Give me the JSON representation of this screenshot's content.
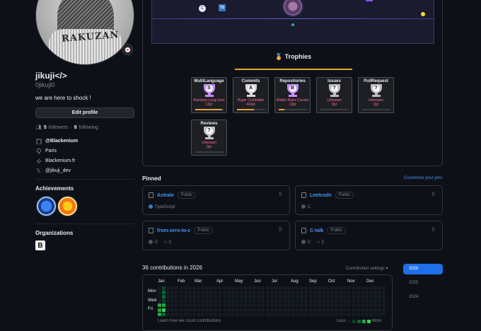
{
  "profile": {
    "avatar_text": "RAKUZAN",
    "name": "jikuji</>",
    "login": "0jikuji0",
    "bio": "we are here to shock !",
    "edit_label": "Edit profile",
    "followers_count": "5",
    "followers_label": "followers",
    "dot_sep": "·",
    "following_count": "8",
    "following_label": "following",
    "company": "@Blackenium",
    "location": "Paris",
    "website": "Blackenium.fr",
    "x_handle": "@jikuji_dev"
  },
  "achievements": {
    "title": "Achievements"
  },
  "organizations": {
    "title": "Organizations",
    "org_letter": "B"
  },
  "readme": {
    "skill_labels": [
      "C",
      "TS"
    ],
    "trophies_title": "🏅 Trophies",
    "trophies": [
      {
        "title": "MultiLanguage",
        "rank": "S",
        "sub": "Rainbow Lang User",
        "pts": "13pt",
        "progress": 0.95,
        "cup": "#c48cff"
      },
      {
        "title": "Commits",
        "rank": "A",
        "sub": "Hyper Committer",
        "pts": "424pt",
        "progress": 0.6,
        "cup": "#d8d8d8"
      },
      {
        "title": "Repositories",
        "rank": "B",
        "sub": "Middle Repo Creator",
        "pts": "12pt",
        "progress": 0.2,
        "cup": "#c48cff"
      },
      {
        "title": "Issues",
        "rank": "?",
        "sub": "Unknown",
        "pts": "0pt",
        "progress": 0.0,
        "cup": "#bdbdbd"
      },
      {
        "title": "PullRequest",
        "rank": "?",
        "sub": "Unknown",
        "pts": "0pt",
        "progress": 0.0,
        "cup": "#bdbdbd"
      },
      {
        "title": "Reviews",
        "rank": "?",
        "sub": "Unknown",
        "pts": "0pt",
        "progress": 0.0,
        "cup": "#bdbdbd"
      }
    ]
  },
  "pinned": {
    "title": "Pinned",
    "customize": "Customize your pins",
    "repos": [
      {
        "name": "Astrale",
        "visibility": "Public",
        "lang": "TypeScript",
        "lang_color": "#3178c6",
        "stars": ""
      },
      {
        "name": "Leetcode",
        "visibility": "Public",
        "lang": "C",
        "lang_color": "#555555",
        "stars": ""
      },
      {
        "name": "from-zero-to-c",
        "visibility": "Public",
        "lang": "C",
        "lang_color": "#555555",
        "stars": "3"
      },
      {
        "name": "C-talk",
        "visibility": "Public",
        "lang": "C",
        "lang_color": "#555555",
        "stars": "3"
      }
    ]
  },
  "contributions": {
    "title": "36 contributions in 2026",
    "settings": "Contribution settings ▾",
    "months": [
      "Jan",
      "Feb",
      "Mar",
      "Apr",
      "May",
      "Jun",
      "Jul",
      "Aug",
      "Sep",
      "Oct",
      "Nov",
      "Dec"
    ],
    "days": [
      "Mon",
      "Wed",
      "Fri"
    ],
    "learn": "Learn how we count contributions",
    "less": "Less",
    "more": "More",
    "colors": [
      "#161b22",
      "#0e4429",
      "#006d32",
      "#26a641",
      "#39d353"
    ]
  },
  "years": [
    "2026",
    "2025",
    "2024"
  ],
  "active_year": "2026"
}
